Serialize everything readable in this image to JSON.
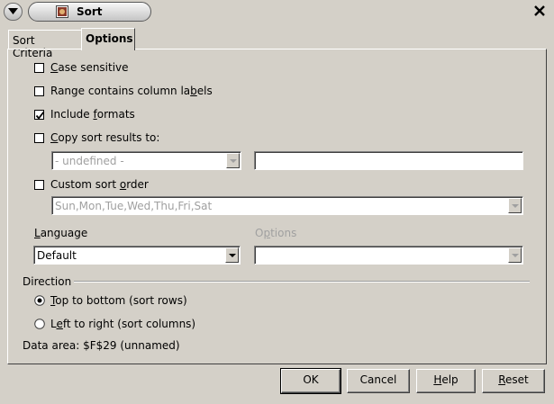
{
  "window": {
    "title": "Sort"
  },
  "tabs": [
    {
      "label": "Sort Criteria",
      "active": false
    },
    {
      "label": "Options",
      "active": true
    }
  ],
  "options": {
    "case_sensitive": {
      "pre": "",
      "u": "C",
      "post": "ase sensitive",
      "checked": false
    },
    "range_headers": {
      "pre": "Range contains column la",
      "u": "b",
      "post": "els",
      "checked": false
    },
    "include_formats": {
      "pre": "Include ",
      "u": "f",
      "post": "ormats",
      "checked": true
    },
    "copy_results": {
      "pre": "",
      "u": "C",
      "post": "opy sort results to:",
      "checked": false
    },
    "copy_target_select": {
      "value": "- undefined -"
    },
    "copy_target_input": {
      "value": ""
    },
    "custom_order": {
      "pre": "Custom sort ",
      "u": "o",
      "post": "rder",
      "checked": false
    },
    "custom_order_select": {
      "value": "Sun,Mon,Tue,Wed,Thu,Fri,Sat"
    },
    "language_label": {
      "pre": "",
      "u": "L",
      "post": "anguage"
    },
    "language_select": {
      "value": "Default"
    },
    "options_label": {
      "pre": "O",
      "u": "p",
      "post": "tions"
    },
    "options_select": {
      "value": ""
    }
  },
  "direction": {
    "heading": "Direction",
    "top_to_bottom": {
      "pre": "",
      "u": "T",
      "post": "op to bottom (sort rows)",
      "selected": true
    },
    "left_to_right": {
      "pre": "L",
      "u": "e",
      "post": "ft to right (sort columns)",
      "selected": false
    }
  },
  "data_area": "Data area: $F$29 (unnamed)",
  "buttons": {
    "ok": {
      "pre": "OK",
      "u": "",
      "post": ""
    },
    "cancel": {
      "pre": "Cancel",
      "u": "",
      "post": ""
    },
    "help": {
      "pre": "",
      "u": "H",
      "post": "elp"
    },
    "reset": {
      "pre": "",
      "u": "R",
      "post": "eset"
    }
  }
}
